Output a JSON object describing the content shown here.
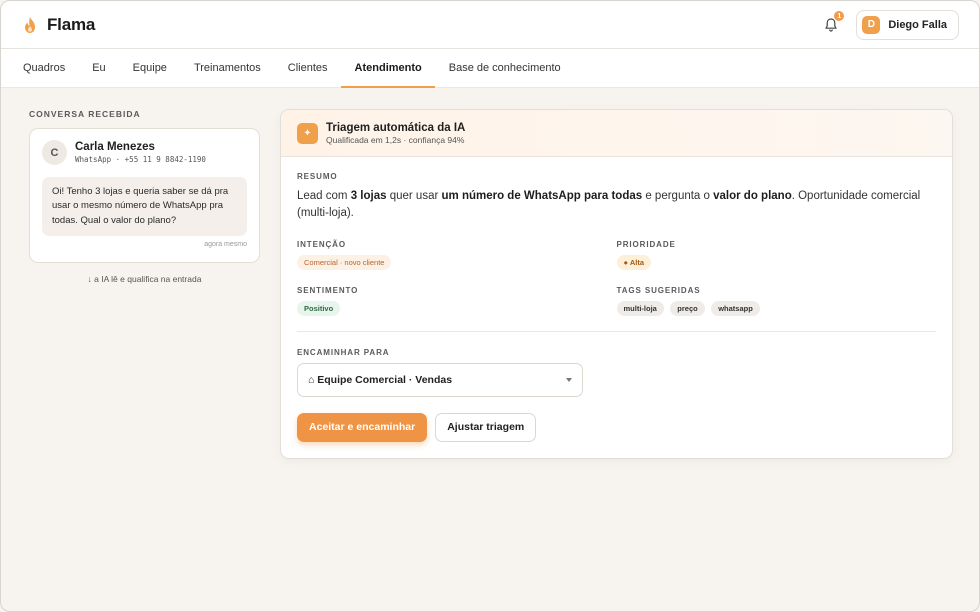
{
  "app": {
    "name": "Flama"
  },
  "header": {
    "notifications_count": "1",
    "user": {
      "initial": "D",
      "name": "Diego Falla"
    }
  },
  "nav": {
    "items": [
      "Quadros",
      "Eu",
      "Equipe",
      "Treinamentos",
      "Clientes",
      "Atendimento",
      "Base de conhecimento"
    ],
    "active": "Atendimento"
  },
  "conversation": {
    "section_label": "CONVERSA RECEBIDA",
    "contact": {
      "initial": "C",
      "name": "Carla Menezes",
      "sub": "WhatsApp · +55 11 9 8842-1190"
    },
    "message": "Oi! Tenho 3 lojas e queria saber se dá pra usar o mesmo número de WhatsApp pra todas. Qual o valor do plano?",
    "time": "agora mesmo",
    "flow_note": "↓ a IA lê e qualifica na entrada"
  },
  "triage": {
    "title": "Triagem automática da IA",
    "subtitle": "Qualificada em 1,2s · confiança 94%",
    "summary_label": "RESUMO",
    "summary": {
      "p1": "Lead com ",
      "b1": "3 lojas",
      "p2": " quer usar ",
      "b2": "um número de WhatsApp para todas",
      "p3": " e pergunta o ",
      "b3": "valor do plano",
      "p4": ". Oportunidade comercial (multi-loja)."
    },
    "intent_label": "INTENÇÃO",
    "intent_value": "Comercial · novo cliente",
    "priority_label": "PRIORIDADE",
    "priority_value": "● Alta",
    "sentiment_label": "SENTIMENTO",
    "sentiment_value": "Positivo",
    "tags_label": "TAGS SUGERIDAS",
    "tags": [
      "multi-loja",
      "preço",
      "whatsapp"
    ],
    "forward_label": "ENCAMINHAR PARA",
    "forward_value": "⌂ Equipe Comercial · Vendas",
    "accept_label": "Aceitar e encaminhar",
    "adjust_label": "Ajustar triagem"
  },
  "colors": {
    "accent": "#f0a04b",
    "primary_button": "#ee9444",
    "background": "#f7f3ef"
  }
}
